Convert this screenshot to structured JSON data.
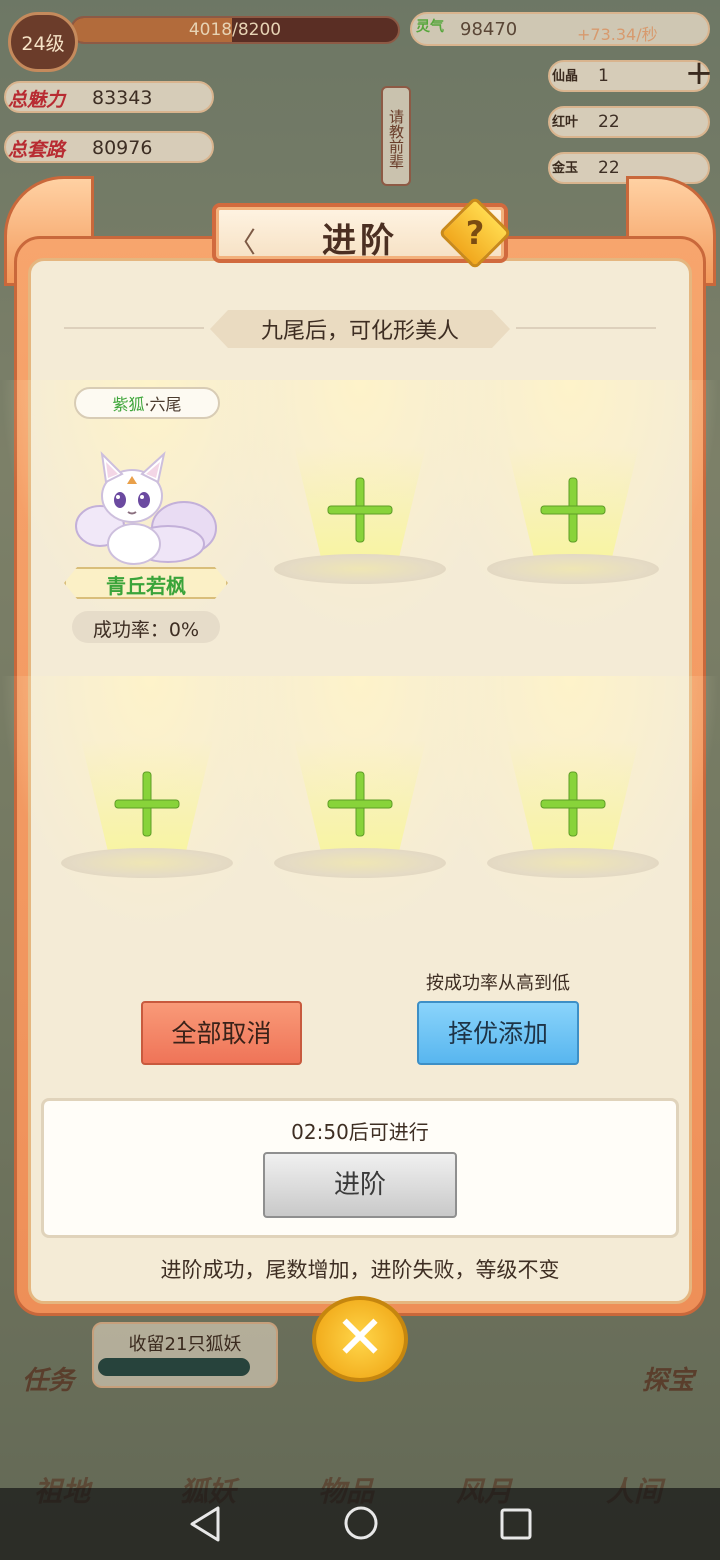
{
  "hud": {
    "level": "24级",
    "exp": "4018/8200",
    "exp_fraction": 0.49,
    "lingqi_label": "灵气",
    "lingqi_value": "98470",
    "lingqi_rate": "+73.34/秒"
  },
  "stats": [
    {
      "label": "总魅力",
      "value": "83343"
    },
    {
      "label": "总套路",
      "value": "80976"
    }
  ],
  "resources": [
    {
      "icon": "仙晶",
      "value": "1"
    },
    {
      "icon": "红叶",
      "value": "22"
    },
    {
      "icon": "金玉",
      "value": "22"
    }
  ],
  "tower": {
    "text": "请教前辈"
  },
  "dialog": {
    "title": "进阶",
    "help": "?",
    "subtitle": "九尾后，可化形美人",
    "fox": {
      "tag_a": "紫狐",
      "tag_sep": "·",
      "tag_b": "六尾",
      "name": "青丘若枫",
      "success_rate": "成功率：0%"
    },
    "slots_count": 5,
    "cancel_label": "全部取消",
    "pick_note": "按成功率从高到低",
    "pick_label": "择优添加",
    "timer_text": "02:50后可进行",
    "advance_label": "进阶",
    "footer_text": "进阶成功，尾数增加，进阶失败，等级不变"
  },
  "background": {
    "task_label": "收留21只狐妖",
    "side_left": "任务",
    "side_right": "探宝"
  },
  "bottom_tabs": [
    "祖地",
    "狐妖",
    "物品",
    "风月",
    "人间"
  ],
  "colors": {
    "accent_orange": "#ee8f58",
    "success_green": "#3fa63b",
    "pick_blue": "#58b6ef",
    "cancel_red": "#ef7458"
  },
  "icons": {
    "help": "question-icon",
    "close": "close-icon",
    "slot": "plus-icon"
  }
}
